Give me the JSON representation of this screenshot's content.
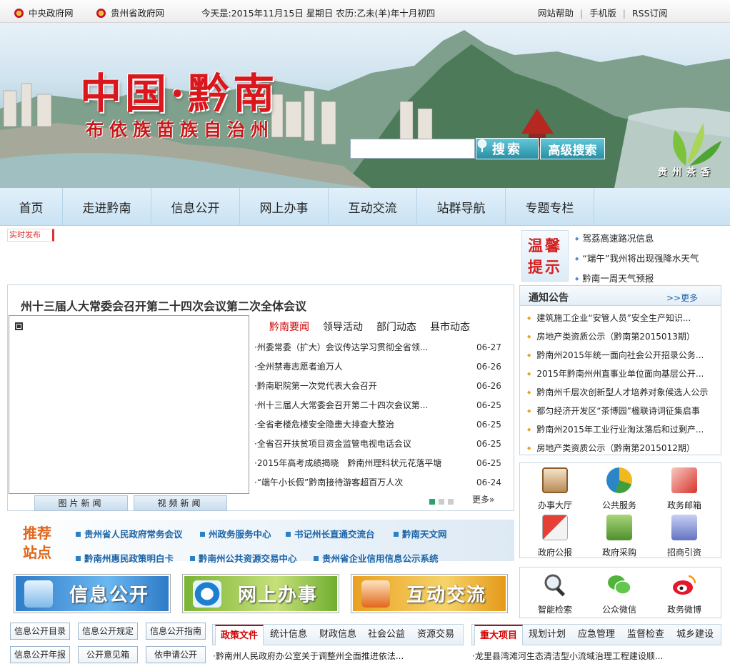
{
  "topbar": {
    "link_central": "中央政府网",
    "link_province": "贵州省政府网",
    "date_text": "今天是:2015年11月15日 星期日 农历:乙未(羊)年十月初四",
    "help": "网站帮助",
    "mobile": "手机版",
    "rss": "RSS订阅",
    "separator": "|"
  },
  "banner": {
    "title": "中国·黔南",
    "subtitle": "布依族苗族自治州",
    "search_placeholder": "",
    "search_button": "搜索",
    "advanced_search": "高级搜索",
    "tea_text": "贵州茶香"
  },
  "nav": [
    "首页",
    "走进黔南",
    "信息公开",
    "网上办事",
    "互动交流",
    "站群导航",
    "专题专栏"
  ],
  "live_tag": "实时发布",
  "headline": "州十三届人大常委会召开第二十四次会议第二次全体会议",
  "photo_tabs": [
    "图片新闻",
    "视频新闻"
  ],
  "news_tabs": [
    "黔南要闻",
    "领导活动",
    "部门动态",
    "县市动态"
  ],
  "news_items": [
    {
      "title": "·州委常委（扩大）会议传达学习贯彻全省领...",
      "date": "06-27"
    },
    {
      "title": "·全州禁毒志愿者逾万人",
      "date": "06-26"
    },
    {
      "title": "·黔南职院第一次党代表大会召开",
      "date": "06-26"
    },
    {
      "title": "·州十三届人大常委会召开第二十四次会议第...",
      "date": "06-25"
    },
    {
      "title": "·全省老楼危楼安全隐患大排查大整治",
      "date": "06-25"
    },
    {
      "title": "·全省召开扶贫项目资金监管电视电话会议",
      "date": "06-25"
    },
    {
      "title": "·2015年高考成绩揭晓　黔南州理科状元花落平塘",
      "date": "06-25"
    },
    {
      "title": "·“端午小长假”黔南接待游客超百万人次",
      "date": "06-24"
    }
  ],
  "more_label": "更多»",
  "recommend": {
    "title": "推荐站点",
    "links": [
      "贵州省人民政府常务会议",
      "州政务服务中心",
      "书记州长直通交流台",
      "黔南天文网",
      "黔南州惠民政策明白卡",
      "黔南州公共资源交易中心",
      "贵州省企业信用信息公示系统"
    ]
  },
  "big_buttons": [
    "信息公开",
    "网上办事",
    "互动交流"
  ],
  "info_buttons": [
    "信息公开目录",
    "信息公开规定",
    "信息公开指南",
    "信息公开年报",
    "公开意见箱",
    "依申请公开"
  ],
  "policy_tabs": [
    "政策文件",
    "统计信息",
    "财政信息",
    "社会公益",
    "资源交易"
  ],
  "policy_first": "·黔南州人民政府办公室关于调整州全面推进依法...",
  "project_tabs": [
    "重大项目",
    "规划计划",
    "应急管理",
    "监督检查",
    "城乡建设"
  ],
  "project_first": "·龙里县湾滩河生态清洁型小流域治理工程建设顺...",
  "tips": {
    "title": "温馨提示",
    "items": [
      "驾荔高速路况信息",
      "“端午”我州将出现强降水天气",
      "黔南一周天气预报"
    ]
  },
  "notice": {
    "title": "通知公告",
    "more": ">>更多",
    "items": [
      "建筑施工企业“安管人员”安全生产知识...",
      "房地产类资质公示（黔南第2015013期）",
      "黔南州2015年统一面向社会公开招录公务...",
      "2015年黔南州州直事业单位面向基层公开...",
      "黔南州千层次创新型人才培养对象候选人公示",
      "都匀经济开发区“茶博园”楹联诗词征集启事",
      "黔南州2015年工业行业淘汰落后和过剩产...",
      "房地产类资质公示（黔南第2015012期）"
    ]
  },
  "services": [
    "办事大厅",
    "公共服务",
    "政务邮箱",
    "政府公报",
    "政府采购",
    "招商引资"
  ],
  "social": [
    "智能检索",
    "公众微信",
    "政务微博"
  ],
  "colors": {
    "accent_red": "#d20000",
    "link_blue": "#1b64a7",
    "nav_bg": "#cfe5f5",
    "orange": "#e0661a"
  }
}
